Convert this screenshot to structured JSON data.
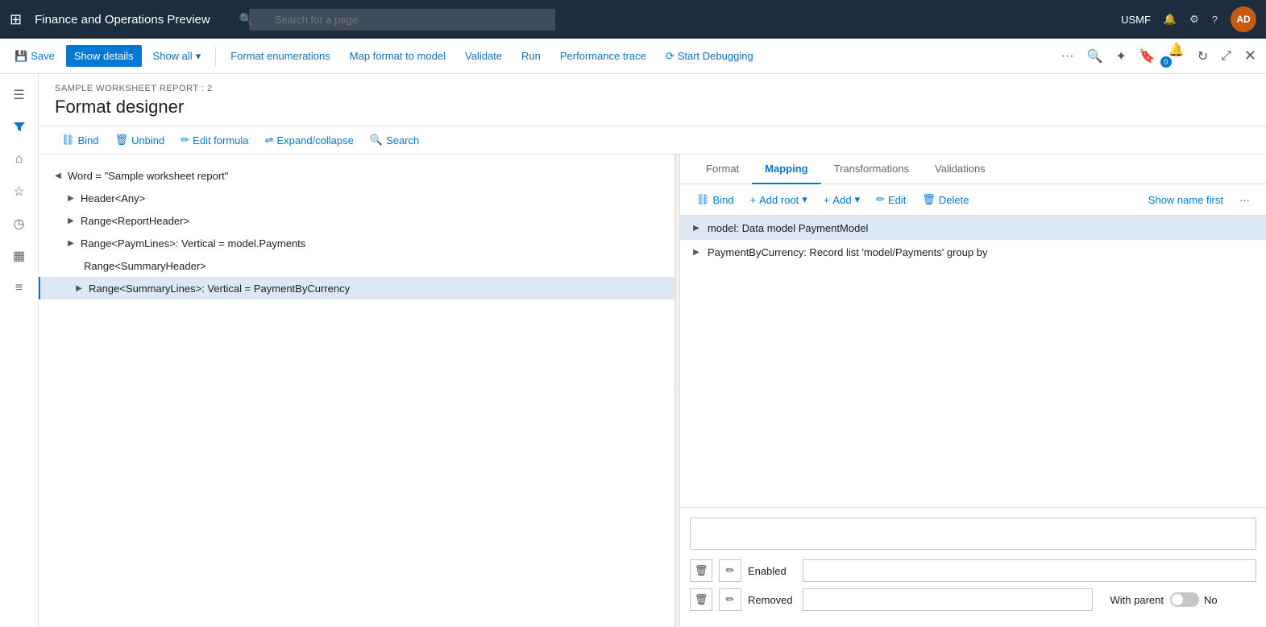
{
  "app": {
    "title": "Finance and Operations Preview",
    "search_placeholder": "Search for a page",
    "user": "USMF",
    "avatar_text": "AD"
  },
  "command_bar": {
    "save_label": "Save",
    "show_details_label": "Show details",
    "show_all_label": "Show all",
    "format_enumerations_label": "Format enumerations",
    "map_format_to_model_label": "Map format to model",
    "validate_label": "Validate",
    "run_label": "Run",
    "performance_trace_label": "Performance trace",
    "start_debugging_label": "Start Debugging",
    "more_label": "..."
  },
  "page": {
    "breadcrumb": "SAMPLE WORKSHEET REPORT : 2",
    "title": "Format designer"
  },
  "sub_commands": {
    "bind_label": "Bind",
    "unbind_label": "Unbind",
    "edit_formula_label": "Edit formula",
    "expand_collapse_label": "Expand/collapse",
    "search_label": "Search"
  },
  "format_tree": {
    "items": [
      {
        "label": "Word = \"Sample worksheet report\"",
        "indent": 0,
        "expanded": true,
        "has_children": true
      },
      {
        "label": "Header<Any>",
        "indent": 1,
        "expanded": false,
        "has_children": true
      },
      {
        "label": "Range<ReportHeader>",
        "indent": 1,
        "expanded": false,
        "has_children": true
      },
      {
        "label": "Range<PaymLines>: Vertical = model.Payments",
        "indent": 1,
        "expanded": false,
        "has_children": true
      },
      {
        "label": "Range<SummaryHeader>",
        "indent": 1,
        "expanded": false,
        "has_children": false
      },
      {
        "label": "Range<SummaryLines>: Vertical = PaymentByCurrency",
        "indent": 1,
        "expanded": false,
        "has_children": true,
        "selected": true
      }
    ]
  },
  "mapping_panel": {
    "tabs": [
      {
        "label": "Format",
        "active": false
      },
      {
        "label": "Mapping",
        "active": true
      },
      {
        "label": "Transformations",
        "active": false
      },
      {
        "label": "Validations",
        "active": false
      }
    ],
    "toolbar": {
      "bind_label": "Bind",
      "add_root_label": "Add root",
      "add_label": "Add",
      "edit_label": "Edit",
      "delete_label": "Delete",
      "show_name_first_label": "Show name first",
      "more_label": "..."
    },
    "tree_items": [
      {
        "label": "model: Data model PaymentModel",
        "indent": 0,
        "expanded": false,
        "has_children": true,
        "selected": true
      },
      {
        "label": "PaymentByCurrency: Record list 'model/Payments' group by",
        "indent": 0,
        "expanded": false,
        "has_children": true,
        "selected": false
      }
    ],
    "formula_box_value": "",
    "fields": [
      {
        "label": "Enabled",
        "input_value": "",
        "right_label": "",
        "toggle": null
      },
      {
        "label": "Removed",
        "input_value": "",
        "right_label": "With parent",
        "toggle": {
          "value": false,
          "label": "No"
        }
      }
    ]
  }
}
